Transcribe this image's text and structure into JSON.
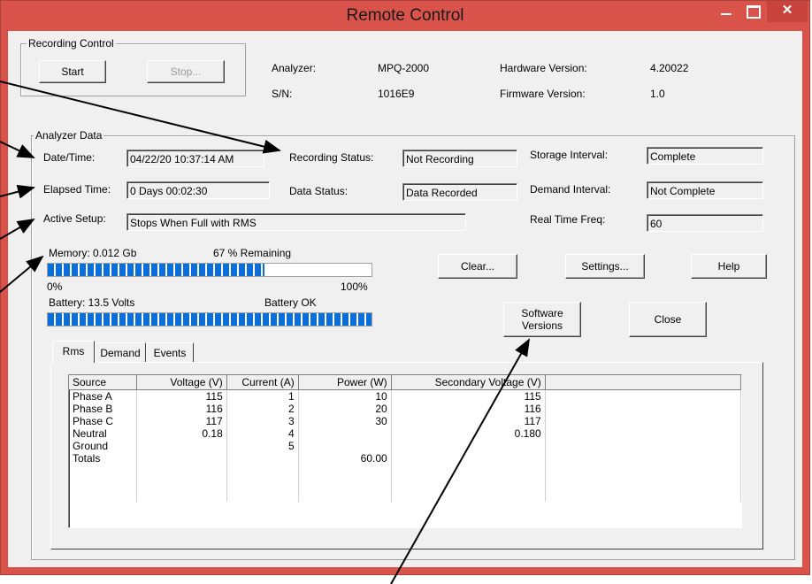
{
  "window": {
    "title": "Remote Control"
  },
  "recording_control": {
    "label": "Recording Control",
    "start": "Start",
    "stop": "Stop..."
  },
  "info": {
    "analyzer_label": "Analyzer:",
    "analyzer": "MPQ-2000",
    "sn_label": "S/N:",
    "sn": "1016E9",
    "hw_label": "Hardware Version:",
    "hw": "4.20022",
    "fw_label": "Firmware Version:",
    "fw": "1.0"
  },
  "analyzer_data": {
    "label": "Analyzer Data",
    "datetime_label": "Date/Time:",
    "datetime": "04/22/20  10:37:14 AM",
    "elapsed_label": "Elapsed Time:",
    "elapsed": "0 Days 00:02:30",
    "setup_label": "Active Setup:",
    "setup": "Stops When Full with RMS",
    "recstatus_label": "Recording Status:",
    "recstatus": "Not Recording",
    "datastatus_label": "Data Status:",
    "datastatus": "Data Recorded",
    "storage_label": "Storage Interval:",
    "storage": "Complete",
    "demand_label": "Demand Interval:",
    "demand": "Not Complete",
    "rtfreq_label": "Real Time Freq:",
    "rtfreq": "60"
  },
  "memory": {
    "label": "Memory:  0.012 Gb",
    "remaining": "67  % Remaining",
    "fill_pct": 0.67,
    "min": "0%",
    "max": "100%"
  },
  "battery": {
    "label": "Battery:  13.5  Volts",
    "status": "Battery OK",
    "fill_pct": 1.0
  },
  "buttons": {
    "clear": "Clear...",
    "settings": "Settings...",
    "help": "Help",
    "software_1": "Software",
    "software_2": "Versions",
    "close": "Close"
  },
  "tabs": [
    "Rms",
    "Demand",
    "Events"
  ],
  "table": {
    "headers": [
      "Source",
      "Voltage (V)",
      "Current (A)",
      "Power (W)",
      "Secondary Voltage (V)"
    ],
    "rows": [
      [
        "Phase A",
        "115",
        "1",
        "10",
        "115"
      ],
      [
        "Phase B",
        "116",
        "2",
        "20",
        "116"
      ],
      [
        "Phase C",
        "117",
        "3",
        "30",
        "117"
      ],
      [
        "Neutral",
        "0.18",
        "4",
        "",
        "0.180"
      ],
      [
        "Ground",
        "",
        "5",
        "",
        ""
      ],
      [
        "Totals",
        "",
        "",
        "60.00",
        ""
      ]
    ]
  },
  "colors": {
    "titlebar": "#d9534a",
    "progress": "#0a6fd8",
    "close_button": "#c7433b"
  },
  "icons": {
    "minimize": "minimize-icon",
    "maximize": "maximize-icon",
    "close": "close-icon"
  }
}
